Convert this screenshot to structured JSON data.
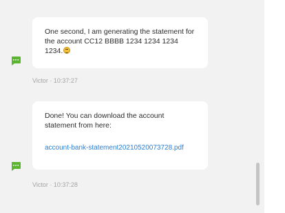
{
  "colors": {
    "background": "#f2f2f2",
    "bubble": "#ffffff",
    "link": "#2a7fd4",
    "meta_text": "#a4a4a4",
    "bot_avatar": "#5bb531"
  },
  "messages": [
    {
      "text": "One second, I am generating the statement for the account CC12 BBBB 1234 1234 1234 1234.",
      "emoji": "smiling-face-emoji",
      "sender": "Victor",
      "time": "10:37:27",
      "meta": "Victor · 10:37:27"
    },
    {
      "text": "Done! You can download the account statement from here:",
      "link": "account-bank-statement20210520073728.pdf",
      "sender": "Victor",
      "time": "10:37:28",
      "meta": "Victor · 10:37:28"
    }
  ],
  "icons": {
    "avatar": "chat-bubble-avatar-icon"
  }
}
